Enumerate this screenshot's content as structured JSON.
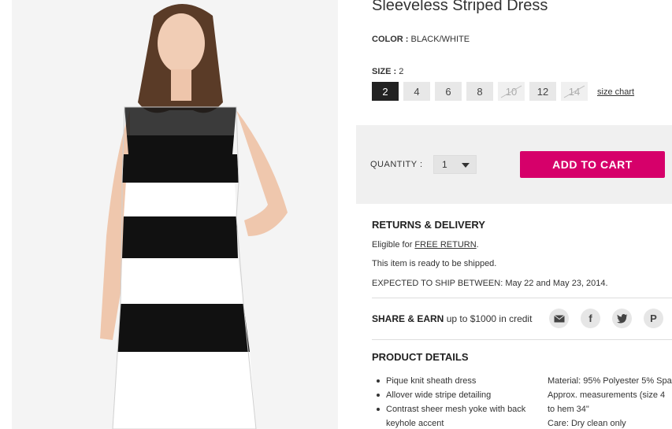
{
  "product": {
    "title": "Sleeveless Striped Dress",
    "color_label": "COLOR :",
    "color_value": "BLACK/WHITE",
    "size_label": "SIZE :",
    "size_value": "2",
    "sizes": [
      "2",
      "4",
      "6",
      "8",
      "10",
      "12",
      "14"
    ],
    "size_chart_link": "size chart"
  },
  "purchase": {
    "quantity_label": "QUANTITY :",
    "quantity_value": "1",
    "add_to_cart": "ADD TO CART",
    "accent_color": "#d6006a"
  },
  "returns": {
    "title": "RETURNS & DELIVERY",
    "eligible_prefix": "Eligible for",
    "free_return": "FREE RETURN",
    "ready": "This item is ready to be shipped.",
    "ship_label": "EXPECTED TO SHIP BETWEEN:",
    "ship_dates": "May 22 and May 23, 2014."
  },
  "share": {
    "label": "SHARE & EARN",
    "text": "up to $1000 in credit",
    "icons": [
      "email-icon",
      "facebook-icon",
      "twitter-icon",
      "pinterest-icon"
    ]
  },
  "details": {
    "title": "PRODUCT DETAILS",
    "bullets": [
      "Pique knit sheath dress",
      "Allover wide stripe detailing",
      "Contrast sheer mesh yoke with back keyhole accent"
    ],
    "material": "Material: 95% Polyester 5% Spa",
    "measurements_1": "Approx. measurements (size 4",
    "measurements_2": "to hem 34\"",
    "care": "Care: Dry clean only"
  }
}
